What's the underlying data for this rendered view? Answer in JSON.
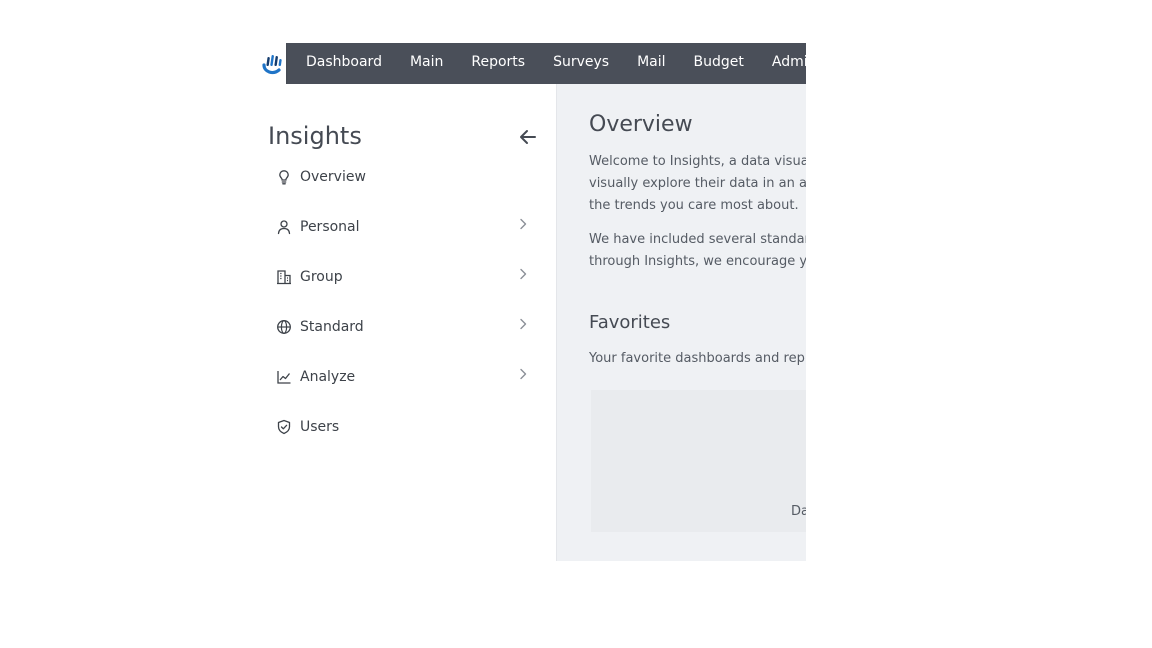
{
  "brand": {
    "logo_icon": "insights-hand-logo-icon",
    "colors": {
      "logo_blue": "#1f74c7",
      "logo_navy": "#143c6e",
      "topbar": "#4a4f59"
    }
  },
  "topnav": {
    "items": [
      {
        "label": "Dashboard"
      },
      {
        "label": "Main"
      },
      {
        "label": "Reports"
      },
      {
        "label": "Surveys"
      },
      {
        "label": "Mail"
      },
      {
        "label": "Budget"
      },
      {
        "label": "Admin"
      }
    ]
  },
  "sidebar": {
    "title": "Insights",
    "back_icon": "arrow-left-icon",
    "items": [
      {
        "label": "Overview",
        "icon": "lightbulb-icon",
        "has_chevron": false
      },
      {
        "label": "Personal",
        "icon": "person-icon",
        "has_chevron": true
      },
      {
        "label": "Group",
        "icon": "building-icon",
        "has_chevron": true
      },
      {
        "label": "Standard",
        "icon": "globe-icon",
        "has_chevron": true
      },
      {
        "label": "Analyze",
        "icon": "line-chart-icon",
        "has_chevron": true
      },
      {
        "label": "Users",
        "icon": "shield-check-icon",
        "has_chevron": false
      }
    ]
  },
  "main": {
    "heading": "Overview",
    "intro_lines": [
      "Welcome to Insights, a data visua",
      "visually explore their data in an a",
      "the trends you care most about."
    ],
    "second_lines": [
      "We have included several standar",
      "through Insights, we encourage y"
    ],
    "favorites_heading": "Favorites",
    "favorites_text": "Your favorite dashboards and rep",
    "favorites_card_text": "Da"
  }
}
